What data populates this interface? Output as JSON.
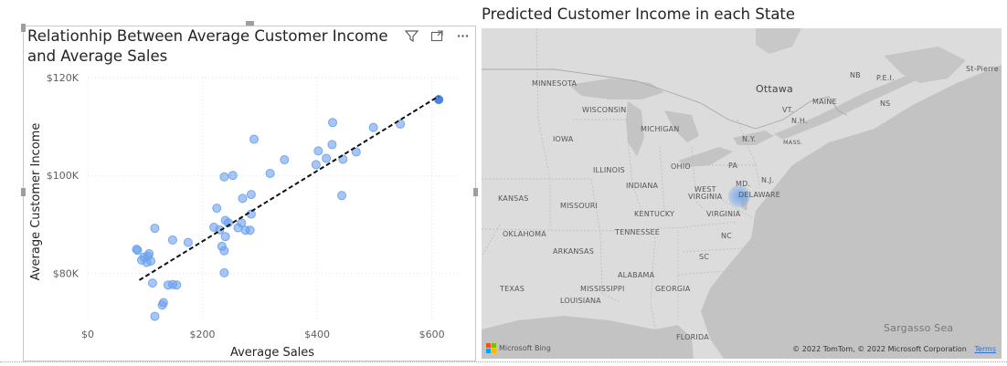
{
  "scatter": {
    "title": "Relationhip Between Average Customer Income and Average Sales",
    "header_icons": [
      "filter-icon",
      "focus-mode-icon",
      "more-options-icon"
    ],
    "point_color": "#6aa0f0",
    "highlight_color": "#3d7de8"
  },
  "chart_data": {
    "type": "scatter",
    "xlabel": "Average Sales",
    "ylabel": "Average Customer Income",
    "xlim": [
      0,
      650
    ],
    "ylim": [
      70000,
      120000
    ],
    "x_ticks": [
      0,
      200,
      400,
      600
    ],
    "x_tick_labels": [
      "$0",
      "$200",
      "$400",
      "$600"
    ],
    "y_ticks": [
      80000,
      100000,
      120000
    ],
    "y_tick_labels": [
      "$80K",
      "$100K",
      "$120K"
    ],
    "grid": true,
    "points": [
      {
        "x": 612,
        "y": 115500,
        "highlight": true
      },
      {
        "x": 545,
        "y": 110500
      },
      {
        "x": 498,
        "y": 109800
      },
      {
        "x": 427,
        "y": 110800
      },
      {
        "x": 426,
        "y": 106300
      },
      {
        "x": 402,
        "y": 105000
      },
      {
        "x": 468,
        "y": 104800
      },
      {
        "x": 445,
        "y": 103300
      },
      {
        "x": 416,
        "y": 103500
      },
      {
        "x": 398,
        "y": 102200
      },
      {
        "x": 443,
        "y": 95900
      },
      {
        "x": 343,
        "y": 103200
      },
      {
        "x": 318,
        "y": 100400
      },
      {
        "x": 290,
        "y": 107400
      },
      {
        "x": 253,
        "y": 100000
      },
      {
        "x": 238,
        "y": 99700
      },
      {
        "x": 285,
        "y": 96100
      },
      {
        "x": 270,
        "y": 95300
      },
      {
        "x": 225,
        "y": 93300
      },
      {
        "x": 240,
        "y": 90800
      },
      {
        "x": 245,
        "y": 90300
      },
      {
        "x": 268,
        "y": 90300
      },
      {
        "x": 285,
        "y": 92100
      },
      {
        "x": 262,
        "y": 89300
      },
      {
        "x": 275,
        "y": 88800
      },
      {
        "x": 283,
        "y": 88800
      },
      {
        "x": 220,
        "y": 89400
      },
      {
        "x": 230,
        "y": 88900
      },
      {
        "x": 240,
        "y": 87500
      },
      {
        "x": 234,
        "y": 85500
      },
      {
        "x": 238,
        "y": 84600
      },
      {
        "x": 175,
        "y": 86300
      },
      {
        "x": 148,
        "y": 86800
      },
      {
        "x": 117,
        "y": 89200
      },
      {
        "x": 85,
        "y": 84900
      },
      {
        "x": 87,
        "y": 84700
      },
      {
        "x": 107,
        "y": 84000
      },
      {
        "x": 105,
        "y": 83500
      },
      {
        "x": 98,
        "y": 83300
      },
      {
        "x": 94,
        "y": 82700
      },
      {
        "x": 110,
        "y": 82500
      },
      {
        "x": 103,
        "y": 82200
      },
      {
        "x": 238,
        "y": 80100
      },
      {
        "x": 113,
        "y": 78000
      },
      {
        "x": 140,
        "y": 77600
      },
      {
        "x": 148,
        "y": 77700
      },
      {
        "x": 155,
        "y": 77600
      },
      {
        "x": 132,
        "y": 74000
      },
      {
        "x": 130,
        "y": 73500
      },
      {
        "x": 117,
        "y": 71200
      }
    ],
    "trend_line": [
      {
        "x": 90,
        "y": 78600
      },
      {
        "x": 612,
        "y": 116200
      }
    ]
  },
  "map": {
    "title": "Predicted Customer Income in each State",
    "attribution": "© 2022 TomTom, © 2022 Microsoft Corporation",
    "terms_link": "Terms",
    "bing_label": "Microsoft Bing",
    "labels": {
      "minnesota": "MINNESOTA",
      "wisconsin": "WISCONSIN",
      "michigan": "MICHIGAN",
      "iowa": "IOWA",
      "illinois": "ILLINOIS",
      "indiana": "INDIANA",
      "ohio": "OHIO",
      "pa": "PA",
      "ny": "N.Y.",
      "vt": "VT.",
      "nh": "N.H.",
      "mass": "MASS.",
      "maine": "MAINE",
      "nb": "NB",
      "pei": "P.E.I.",
      "ns": "NS",
      "ottawa": "Ottawa",
      "stpierre": "St-Pierre",
      "nj": "N.J.",
      "md": "MD.",
      "delaware": "DELAWARE",
      "west_virginia_1": "WEST",
      "west_virginia_2": "VIRGINIA",
      "virginia": "VIRGINIA",
      "kentucky": "KENTUCKY",
      "kansas": "KANSAS",
      "missouri": "MISSOURI",
      "oklahoma": "OKLAHOMA",
      "arkansas": "ARKANSAS",
      "tennessee": "TENNESSEE",
      "nc": "NC",
      "sc": "SC",
      "alabama": "ALABAMA",
      "mississippi": "MISSISSIPPI",
      "georgia": "GEORGIA",
      "louisiana": "LOUISIANA",
      "texas": "TEXAS",
      "florida": "FLORIDA",
      "sargasso": "Sargasso Sea"
    },
    "colors": {
      "land": "#d9d9d9",
      "water": "#bdbdbd",
      "bubble": "#5b9bf0"
    }
  }
}
